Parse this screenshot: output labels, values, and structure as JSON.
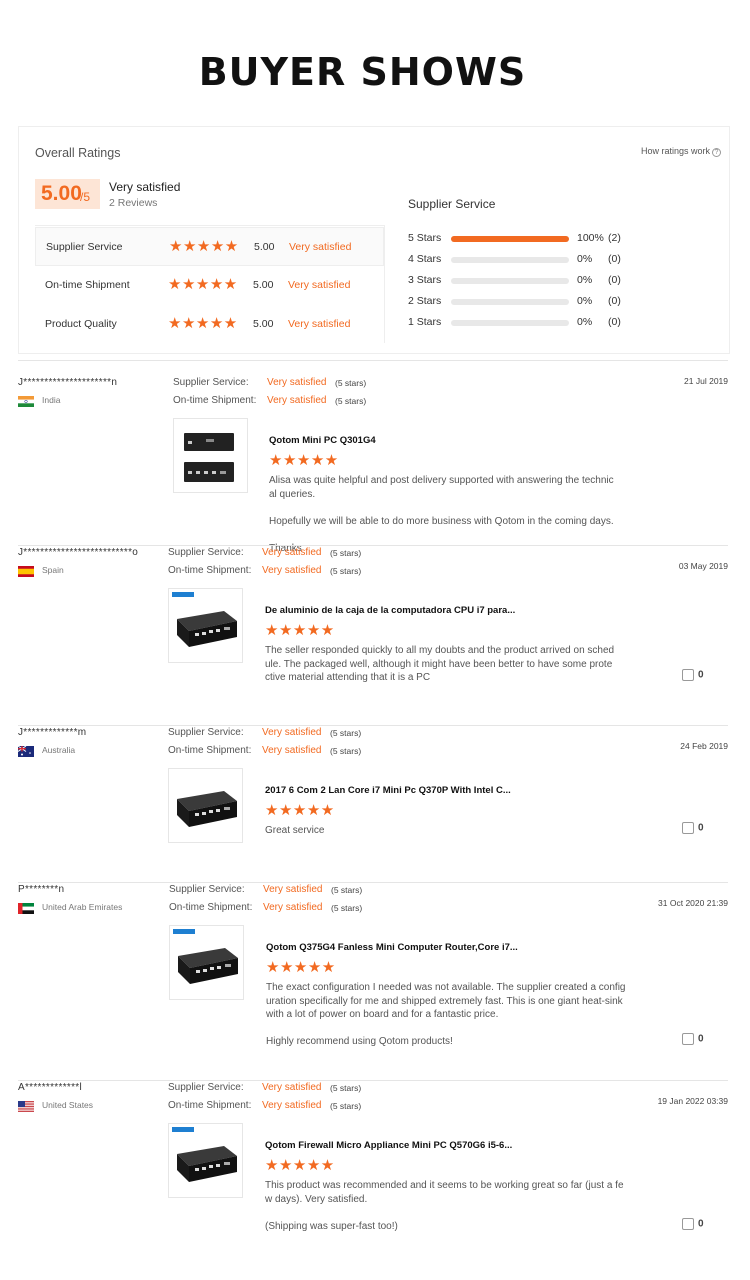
{
  "page_title": "BUYER SHOWS",
  "ratings": {
    "overall_label": "Overall Ratings",
    "how_link": "How ratings work",
    "score": "5.00",
    "score_denom": "/5",
    "score_text": "Very satisfied",
    "reviews": "2 Reviews",
    "categories": [
      {
        "name": "Supplier Service",
        "stars": "★★★★★",
        "score": "5.00",
        "text": "Very satisfied"
      },
      {
        "name": "On-time Shipment",
        "stars": "★★★★★",
        "score": "5.00",
        "text": "Very satisfied"
      },
      {
        "name": "Product Quality",
        "stars": "★★★★★",
        "score": "5.00",
        "text": "Very satisfied"
      }
    ],
    "supplier_service": {
      "title": "Supplier Service",
      "bars": [
        {
          "label": "5  Stars",
          "fraction": 1.0,
          "pct": "100%",
          "count": "(2)"
        },
        {
          "label": "4  Stars",
          "fraction": 0,
          "pct": "0%",
          "count": "(0)"
        },
        {
          "label": "3  Stars",
          "fraction": 0,
          "pct": "0%",
          "count": "(0)"
        },
        {
          "label": "2  Stars",
          "fraction": 0,
          "pct": "0%",
          "count": "(0)"
        },
        {
          "label": "1  Stars",
          "fraction": 0,
          "pct": "0%",
          "count": "(0)"
        }
      ]
    }
  },
  "reviews": [
    {
      "name": "J*********************n",
      "country": "India",
      "flag": "india",
      "ss_label": "Supplier Service:",
      "ss_value": "Very satisfied",
      "ss_stars": "(5 stars)",
      "os_label": "On-time Shipment:",
      "os_value": "Very satisfied",
      "os_stars": "(5 stars)",
      "date": "21 Jul 2019",
      "product": "Qotom Mini PC Q301G4",
      "stars": "★★★★★",
      "text": "Alisa was quite helpful and post delivery supported with answering the technic\nal queries.\n\nHopefully we will be able to do more business with Qotom in the coming days.\n\nThanks",
      "likes": ""
    },
    {
      "name": "J**************************o",
      "country": "Spain",
      "flag": "spain",
      "ss_label": "Supplier Service:",
      "ss_value": "Very satisfied",
      "ss_stars": "(5 stars)",
      "os_label": "On-time Shipment:",
      "os_value": "Very satisfied",
      "os_stars": "(5 stars)",
      "date": "03 May 2019",
      "product": "De aluminio de la caja de la computadora CPU i7 para...",
      "stars": "★★★★★",
      "text": "The seller responded quickly to all my doubts and the product arrived on sched\nule. The packaged well, although it might have been better to have some prote\nctive material attending that it is a PC",
      "likes": "0"
    },
    {
      "name": "J*************m",
      "country": "Australia",
      "flag": "australia",
      "ss_label": "Supplier Service:",
      "ss_value": "Very satisfied",
      "ss_stars": "(5 stars)",
      "os_label": "On-time Shipment:",
      "os_value": "Very satisfied",
      "os_stars": "(5 stars)",
      "date": "24 Feb 2019",
      "product": "2017 6 Com 2 Lan Core i7 Mini Pc Q370P With Intel C...",
      "stars": "★★★★★",
      "text": "Great service",
      "likes": "0"
    },
    {
      "name": "P********n",
      "country": "United Arab Emirates",
      "flag": "uae",
      "ss_label": "Supplier Service:",
      "ss_value": "Very satisfied",
      "ss_stars": "(5 stars)",
      "os_label": "On-time Shipment:",
      "os_value": "Very satisfied",
      "os_stars": "(5 stars)",
      "date": "31 Oct 2020 21:39",
      "product": "Qotom Q375G4 Fanless Mini Computer Router,Core i7...",
      "stars": "★★★★★",
      "text": "The exact configuration I needed was not available. The supplier created a config\nuration specifically for me and shipped extremely fast. This is one giant heat-sink\nwith a lot of power on board and for a fantastic price.\n\nHighly recommend using Qotom products!",
      "likes": "0"
    },
    {
      "name": "A*************l",
      "country": "United States",
      "flag": "usa",
      "ss_label": "Supplier Service:",
      "ss_value": "Very satisfied",
      "ss_stars": "(5 stars)",
      "os_label": "On-time Shipment:",
      "os_value": "Very satisfied",
      "os_stars": "(5 stars)",
      "date": "19 Jan 2022 03:39",
      "product": "Qotom Firewall Micro Appliance Mini PC Q570G6 i5-6...",
      "stars": "★★★★★",
      "text": "This product was recommended and it seems to be working great so far (just a fe\nw days). Very satisfied.\n\n(Shipping was super-fast too!)",
      "likes": "0"
    }
  ],
  "colors": {
    "accent": "#f26a21",
    "bar_track": "#e8e8e8"
  }
}
